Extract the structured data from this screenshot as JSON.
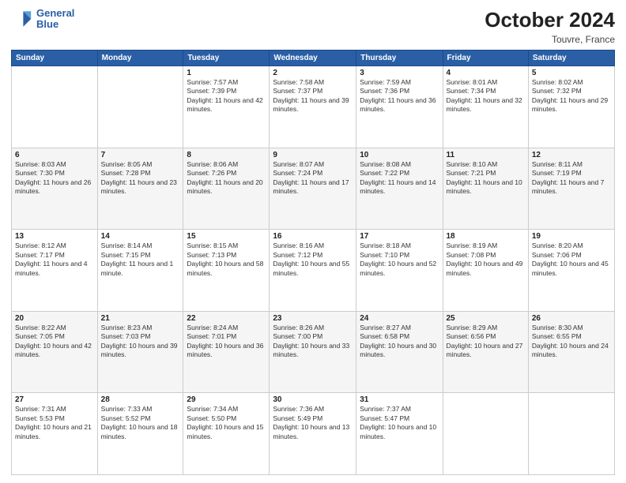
{
  "header": {
    "logo_line1": "General",
    "logo_line2": "Blue",
    "month": "October 2024",
    "location": "Touvre, France"
  },
  "days_of_week": [
    "Sunday",
    "Monday",
    "Tuesday",
    "Wednesday",
    "Thursday",
    "Friday",
    "Saturday"
  ],
  "weeks": [
    [
      {
        "day": "",
        "info": ""
      },
      {
        "day": "",
        "info": ""
      },
      {
        "day": "1",
        "info": "Sunrise: 7:57 AM\nSunset: 7:39 PM\nDaylight: 11 hours and 42 minutes."
      },
      {
        "day": "2",
        "info": "Sunrise: 7:58 AM\nSunset: 7:37 PM\nDaylight: 11 hours and 39 minutes."
      },
      {
        "day": "3",
        "info": "Sunrise: 7:59 AM\nSunset: 7:36 PM\nDaylight: 11 hours and 36 minutes."
      },
      {
        "day": "4",
        "info": "Sunrise: 8:01 AM\nSunset: 7:34 PM\nDaylight: 11 hours and 32 minutes."
      },
      {
        "day": "5",
        "info": "Sunrise: 8:02 AM\nSunset: 7:32 PM\nDaylight: 11 hours and 29 minutes."
      }
    ],
    [
      {
        "day": "6",
        "info": "Sunrise: 8:03 AM\nSunset: 7:30 PM\nDaylight: 11 hours and 26 minutes."
      },
      {
        "day": "7",
        "info": "Sunrise: 8:05 AM\nSunset: 7:28 PM\nDaylight: 11 hours and 23 minutes."
      },
      {
        "day": "8",
        "info": "Sunrise: 8:06 AM\nSunset: 7:26 PM\nDaylight: 11 hours and 20 minutes."
      },
      {
        "day": "9",
        "info": "Sunrise: 8:07 AM\nSunset: 7:24 PM\nDaylight: 11 hours and 17 minutes."
      },
      {
        "day": "10",
        "info": "Sunrise: 8:08 AM\nSunset: 7:22 PM\nDaylight: 11 hours and 14 minutes."
      },
      {
        "day": "11",
        "info": "Sunrise: 8:10 AM\nSunset: 7:21 PM\nDaylight: 11 hours and 10 minutes."
      },
      {
        "day": "12",
        "info": "Sunrise: 8:11 AM\nSunset: 7:19 PM\nDaylight: 11 hours and 7 minutes."
      }
    ],
    [
      {
        "day": "13",
        "info": "Sunrise: 8:12 AM\nSunset: 7:17 PM\nDaylight: 11 hours and 4 minutes."
      },
      {
        "day": "14",
        "info": "Sunrise: 8:14 AM\nSunset: 7:15 PM\nDaylight: 11 hours and 1 minute."
      },
      {
        "day": "15",
        "info": "Sunrise: 8:15 AM\nSunset: 7:13 PM\nDaylight: 10 hours and 58 minutes."
      },
      {
        "day": "16",
        "info": "Sunrise: 8:16 AM\nSunset: 7:12 PM\nDaylight: 10 hours and 55 minutes."
      },
      {
        "day": "17",
        "info": "Sunrise: 8:18 AM\nSunset: 7:10 PM\nDaylight: 10 hours and 52 minutes."
      },
      {
        "day": "18",
        "info": "Sunrise: 8:19 AM\nSunset: 7:08 PM\nDaylight: 10 hours and 49 minutes."
      },
      {
        "day": "19",
        "info": "Sunrise: 8:20 AM\nSunset: 7:06 PM\nDaylight: 10 hours and 45 minutes."
      }
    ],
    [
      {
        "day": "20",
        "info": "Sunrise: 8:22 AM\nSunset: 7:05 PM\nDaylight: 10 hours and 42 minutes."
      },
      {
        "day": "21",
        "info": "Sunrise: 8:23 AM\nSunset: 7:03 PM\nDaylight: 10 hours and 39 minutes."
      },
      {
        "day": "22",
        "info": "Sunrise: 8:24 AM\nSunset: 7:01 PM\nDaylight: 10 hours and 36 minutes."
      },
      {
        "day": "23",
        "info": "Sunrise: 8:26 AM\nSunset: 7:00 PM\nDaylight: 10 hours and 33 minutes."
      },
      {
        "day": "24",
        "info": "Sunrise: 8:27 AM\nSunset: 6:58 PM\nDaylight: 10 hours and 30 minutes."
      },
      {
        "day": "25",
        "info": "Sunrise: 8:29 AM\nSunset: 6:56 PM\nDaylight: 10 hours and 27 minutes."
      },
      {
        "day": "26",
        "info": "Sunrise: 8:30 AM\nSunset: 6:55 PM\nDaylight: 10 hours and 24 minutes."
      }
    ],
    [
      {
        "day": "27",
        "info": "Sunrise: 7:31 AM\nSunset: 5:53 PM\nDaylight: 10 hours and 21 minutes."
      },
      {
        "day": "28",
        "info": "Sunrise: 7:33 AM\nSunset: 5:52 PM\nDaylight: 10 hours and 18 minutes."
      },
      {
        "day": "29",
        "info": "Sunrise: 7:34 AM\nSunset: 5:50 PM\nDaylight: 10 hours and 15 minutes."
      },
      {
        "day": "30",
        "info": "Sunrise: 7:36 AM\nSunset: 5:49 PM\nDaylight: 10 hours and 13 minutes."
      },
      {
        "day": "31",
        "info": "Sunrise: 7:37 AM\nSunset: 5:47 PM\nDaylight: 10 hours and 10 minutes."
      },
      {
        "day": "",
        "info": ""
      },
      {
        "day": "",
        "info": ""
      }
    ]
  ]
}
